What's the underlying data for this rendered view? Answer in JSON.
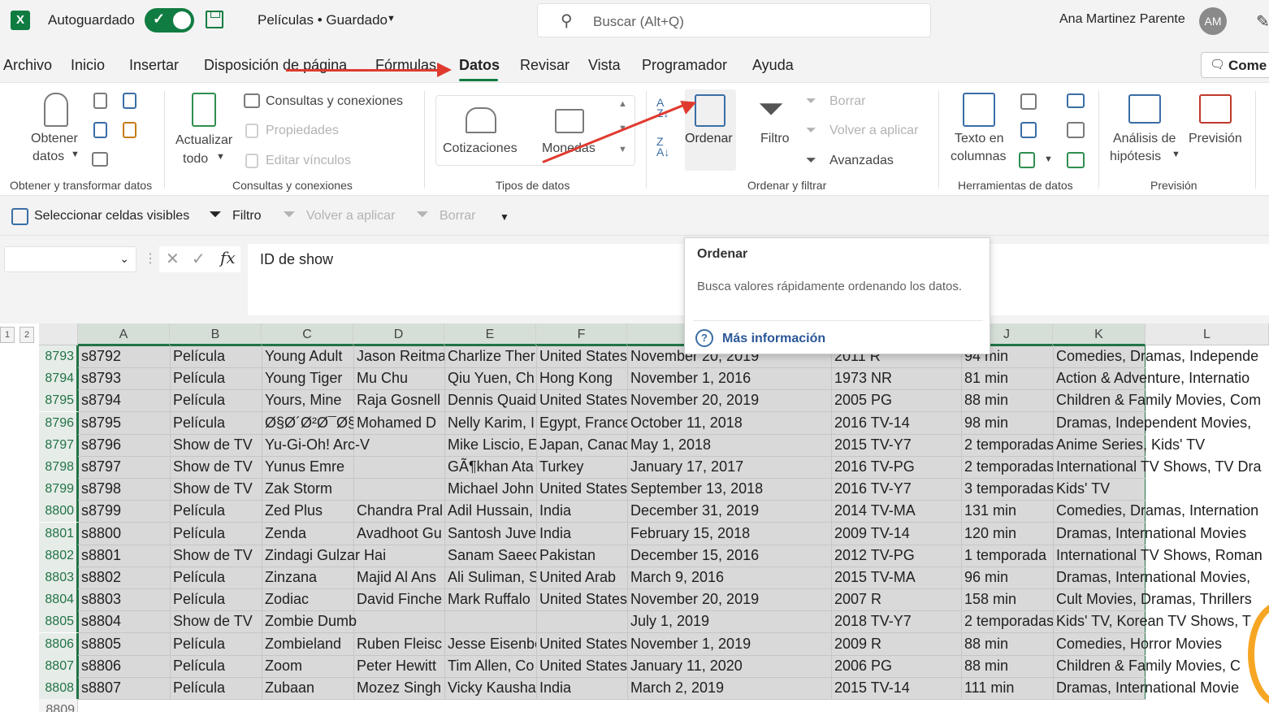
{
  "titlebar": {
    "autosave_label": "Autoguardado",
    "doc_title": "Películas • Guardado",
    "search_placeholder": "Buscar (Alt+Q)",
    "user_name": "Ana Martinez Parente",
    "user_initials": "AM"
  },
  "menu": {
    "tabs": [
      "Archivo",
      "Inicio",
      "Insertar",
      "Disposición de página",
      "Fórmulas",
      "Datos",
      "Revisar",
      "Vista",
      "Programador",
      "Ayuda"
    ],
    "active_tab": "Datos",
    "comment_label": "Come"
  },
  "ribbon": {
    "get_data": "Obtener datos",
    "get_data_line1": "Obtener",
    "get_data_line2": "datos",
    "group_get_transform": "Obtener y transformar datos",
    "refresh_line1": "Actualizar",
    "refresh_line2": "todo",
    "queries_connections": "Consultas y conexiones",
    "properties": "Propiedades",
    "edit_links": "Editar vínculos",
    "group_queries": "Consultas y conexiones",
    "stocks": "Cotizaciones",
    "currencies": "Monedas",
    "group_data_types": "Tipos de datos",
    "sort": "Ordenar",
    "filter": "Filtro",
    "clear": "Borrar",
    "reapply": "Volver a aplicar",
    "advanced": "Avanzadas",
    "group_sort_filter": "Ordenar y filtrar",
    "text_to_columns_line1": "Texto en",
    "text_to_columns_line2": "columnas",
    "group_data_tools": "Herramientas de datos",
    "whatif_line1": "Análisis de",
    "whatif_line2": "hipótesis",
    "forecast": "Previsión",
    "group_forecast": "Previsión"
  },
  "quickbar": {
    "select_visible": "Seleccionar celdas visibles",
    "filter": "Filtro",
    "reapply": "Volver a aplicar",
    "clear": "Borrar"
  },
  "formula": {
    "value": "ID de show"
  },
  "tooltip": {
    "title": "Ordenar",
    "description": "Busca valores rápidamente ordenando los datos.",
    "link": "Más información"
  },
  "grid": {
    "outline_levels": [
      "1",
      "2"
    ],
    "columns": [
      "A",
      "B",
      "C",
      "D",
      "E",
      "F",
      "",
      "",
      "J",
      "K",
      "L"
    ],
    "rows": [
      {
        "n": "8793",
        "A": "s8792",
        "B": "Película",
        "C": "Young Adult",
        "D": "Jason Reitma",
        "E": "Charlize Ther",
        "F": "United States",
        "G": "November 20, 2019",
        "H": "2011 R",
        "J": "94 min",
        "K": "Comedies, Dramas, Independe"
      },
      {
        "n": "8794",
        "A": "s8793",
        "B": "Película",
        "C": "Young Tiger",
        "D": "Mu Chu",
        "E": "Qiu Yuen, Ch",
        "F": "Hong Kong",
        "G": "November 1, 2016",
        "H": "1973 NR",
        "J": "81 min",
        "K": "Action & Adventure, Internatio"
      },
      {
        "n": "8795",
        "A": "s8794",
        "B": "Película",
        "C": "Yours, Mine",
        "D": "Raja Gosnell",
        "E": "Dennis Quaid",
        "F": "United States",
        "G": "November 20, 2019",
        "H": "2005 PG",
        "J": "88 min",
        "K": "Children & Family Movies, Com"
      },
      {
        "n": "8796",
        "A": "s8795",
        "B": "Película",
        "C": "Ø§Ø´Ø²Ø¯Ø§",
        "D": "Mohamed D",
        "E": "Nelly Karim, I",
        "F": "Egypt, France",
        "G": "October 11, 2018",
        "H": "2016 TV-14",
        "J": "98 min",
        "K": "Dramas, Independent Movies,"
      },
      {
        "n": "8797",
        "A": "s8796",
        "B": "Show de TV",
        "C": "Yu-Gi-Oh! Arc-V",
        "D": "",
        "E": "Mike Liscio, E",
        "F": "Japan, Canad",
        "G": "May 1, 2018",
        "H": "2015 TV-Y7",
        "J": "2 temporadas",
        "K": "Anime Series, Kids' TV"
      },
      {
        "n": "8798",
        "A": "s8797",
        "B": "Show de TV",
        "C": "Yunus Emre",
        "D": "",
        "E": "GÃ¶khan Ata",
        "F": "Turkey",
        "G": "January 17, 2017",
        "H": "2016 TV-PG",
        "J": "2 temporadas",
        "K": "International TV Shows, TV Dra"
      },
      {
        "n": "8799",
        "A": "s8798",
        "B": "Show de TV",
        "C": "Zak Storm",
        "D": "",
        "E": "Michael John",
        "F": "United States",
        "G": "September 13, 2018",
        "H": "2016 TV-Y7",
        "J": "3 temporadas",
        "K": "Kids' TV"
      },
      {
        "n": "8800",
        "A": "s8799",
        "B": "Película",
        "C": "Zed Plus",
        "D": "Chandra Pral",
        "E": "Adil Hussain,",
        "F": "India",
        "G": "December 31, 2019",
        "H": "2014 TV-MA",
        "J": "131 min",
        "K": "Comedies, Dramas, Internation"
      },
      {
        "n": "8801",
        "A": "s8800",
        "B": "Película",
        "C": "Zenda",
        "D": "Avadhoot Gu",
        "E": "Santosh Juve",
        "F": "India",
        "G": "February 15, 2018",
        "H": "2009 TV-14",
        "J": "120 min",
        "K": "Dramas, International Movies"
      },
      {
        "n": "8802",
        "A": "s8801",
        "B": "Show de TV",
        "C": "Zindagi Gulzar Hai",
        "D": "",
        "E": "Sanam Saeed",
        "F": "Pakistan",
        "G": "December 15, 2016",
        "H": "2012 TV-PG",
        "J": "1 temporada",
        "K": "International TV Shows, Roman"
      },
      {
        "n": "8803",
        "A": "s8802",
        "B": "Película",
        "C": "Zinzana",
        "D": "Majid Al Ans",
        "E": "Ali Suliman, S",
        "F": "United Arab",
        "G": "March 9, 2016",
        "H": "2015 TV-MA",
        "J": "96 min",
        "K": "Dramas, International Movies,"
      },
      {
        "n": "8804",
        "A": "s8803",
        "B": "Película",
        "C": "Zodiac",
        "D": "David Finche",
        "E": "Mark Ruffalo",
        "F": "United States",
        "G": "November 20, 2019",
        "H": "2007 R",
        "J": "158 min",
        "K": "Cult Movies, Dramas, Thrillers"
      },
      {
        "n": "8805",
        "A": "s8804",
        "B": "Show de TV",
        "C": "Zombie Dumb",
        "D": "",
        "E": "",
        "F": "",
        "G": "July 1, 2019",
        "H": "2018 TV-Y7",
        "J": "2 temporadas",
        "K": "Kids' TV, Korean TV Shows, T"
      },
      {
        "n": "8806",
        "A": "s8805",
        "B": "Película",
        "C": "Zombieland",
        "D": "Ruben Fleisc",
        "E": "Jesse Eisenbe",
        "F": "United States",
        "G": "November 1, 2019",
        "H": "2009 R",
        "J": "88 min",
        "K": "Comedies, Horror Movies"
      },
      {
        "n": "8807",
        "A": "s8806",
        "B": "Película",
        "C": "Zoom",
        "D": "Peter Hewitt",
        "E": "Tim Allen, Co",
        "F": "United States",
        "G": "January 11, 2020",
        "H": "2006 PG",
        "J": "88 min",
        "K": "Children & Family Movies, C"
      },
      {
        "n": "8808",
        "A": "s8807",
        "B": "Película",
        "C": "Zubaan",
        "D": "Mozez Singh",
        "E": "Vicky Kausha",
        "F": "India",
        "G": "March 2, 2019",
        "H": "2015 TV-14",
        "J": "111 min",
        "K": "Dramas, International Movie"
      },
      {
        "n": "8809"
      }
    ]
  },
  "colors": {
    "excel_green": "#107c41",
    "annotation_red": "#e03a2f"
  }
}
